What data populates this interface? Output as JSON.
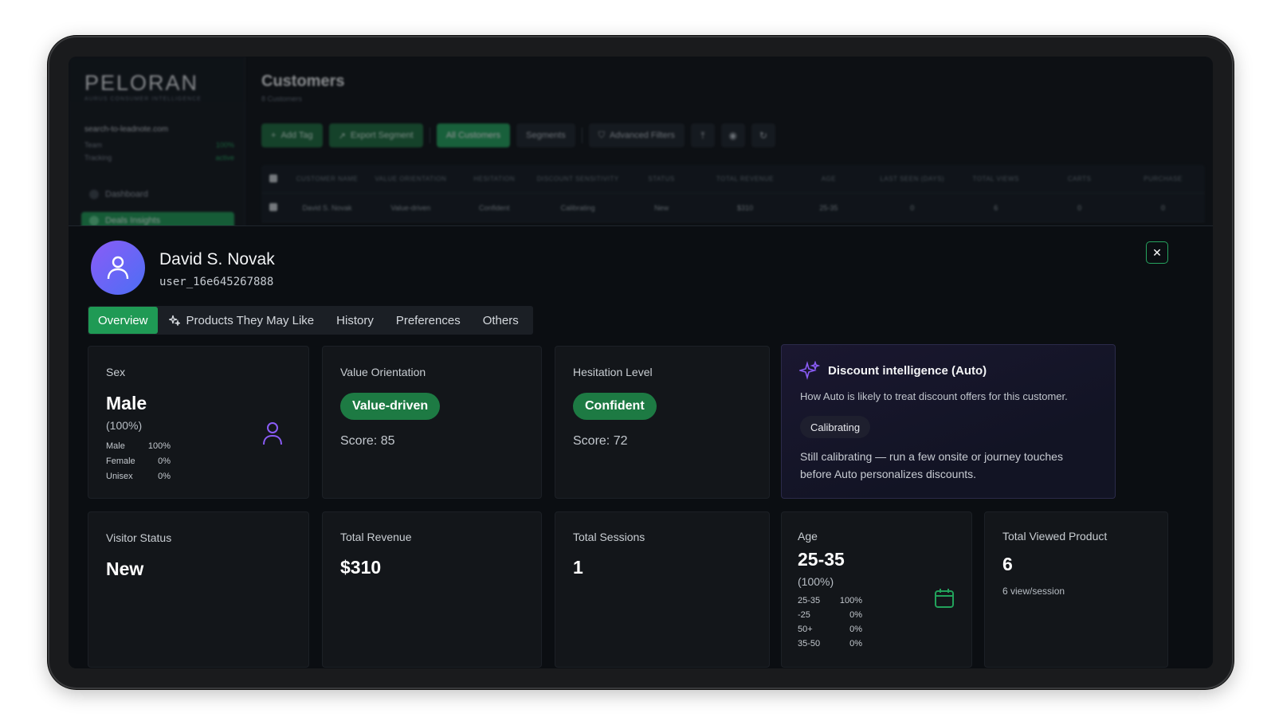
{
  "background": {
    "logo": "PELORAN",
    "logo_sub": "AURUS CONSUMER INTELLIGENCE",
    "account": "search-to-leadnote.com",
    "side_rows": [
      {
        "label": "Team",
        "value": "100%"
      },
      {
        "label": "Tracking",
        "value": "active"
      }
    ],
    "nav": [
      {
        "label": "Dashboard",
        "active": false
      },
      {
        "label": "Deals Insights",
        "active": true
      }
    ],
    "page_title": "Customers",
    "page_sub": "8 Customers",
    "toolbar": {
      "add_tag": "Add Tag",
      "export_segment": "Export Segment",
      "all_customers": "All Customers",
      "segments": "Segments",
      "advanced_filters": "Advanced Filters"
    },
    "table": {
      "columns": [
        "CUSTOMER NAME",
        "VALUE ORIENTATION",
        "HESITATION",
        "DISCOUNT SENSITIVITY",
        "STATUS",
        "TOTAL REVENUE",
        "AGE",
        "LAST SEEN (DAYS)",
        "TOTAL VIEWS",
        "CARTS",
        "PURCHASE"
      ],
      "rows": [
        [
          "David S. Novak",
          "Value-driven",
          "Confident",
          "Calibrating",
          "New",
          "$310",
          "25-35",
          "0",
          "6",
          "0",
          "0"
        ]
      ]
    }
  },
  "modal": {
    "name": "David S. Novak",
    "user_id": "user_16e645267888",
    "tabs": [
      {
        "label": "Overview",
        "active": true,
        "icon": ""
      },
      {
        "label": "Products They May Like",
        "active": false,
        "icon": "sparkle-icon"
      },
      {
        "label": "History",
        "active": false,
        "icon": ""
      },
      {
        "label": "Preferences",
        "active": false,
        "icon": ""
      },
      {
        "label": "Others",
        "active": false,
        "icon": ""
      }
    ],
    "sex": {
      "label": "Sex",
      "value": "Male",
      "pct": "(100%)",
      "breakdown": [
        {
          "k": "Male",
          "v": "100%"
        },
        {
          "k": "Female",
          "v": "0%"
        },
        {
          "k": "Unisex",
          "v": "0%"
        }
      ]
    },
    "value_orientation": {
      "label": "Value Orientation",
      "pill": "Value-driven",
      "score": "Score: 85"
    },
    "hesitation": {
      "label": "Hesitation Level",
      "pill": "Confident",
      "score": "Score: 72"
    },
    "discount": {
      "title": "Discount intelligence (Auto)",
      "desc": "How Auto is likely to treat discount offers for this customer.",
      "chip": "Calibrating",
      "text": "Still calibrating — run a few onsite or journey touches before Auto personalizes discounts."
    },
    "visitor_status": {
      "label": "Visitor Status",
      "value": "New"
    },
    "total_revenue": {
      "label": "Total Revenue",
      "value": "$310"
    },
    "total_sessions": {
      "label": "Total Sessions",
      "value": "1"
    },
    "age": {
      "label": "Age",
      "value": "25-35",
      "pct": "(100%)",
      "breakdown": [
        {
          "k": "25-35",
          "v": "100%"
        },
        {
          "k": "-25",
          "v": "0%"
        },
        {
          "k": "50+",
          "v": "0%"
        },
        {
          "k": "35-50",
          "v": "0%"
        }
      ]
    },
    "total_viewed": {
      "label": "Total Viewed Product",
      "value": "6",
      "sub": "6 view/session"
    },
    "colors": {
      "accent": "#1f9a55",
      "purple": "#8a5cf6",
      "bg": "#0b0e12",
      "card": "#13161a"
    }
  }
}
